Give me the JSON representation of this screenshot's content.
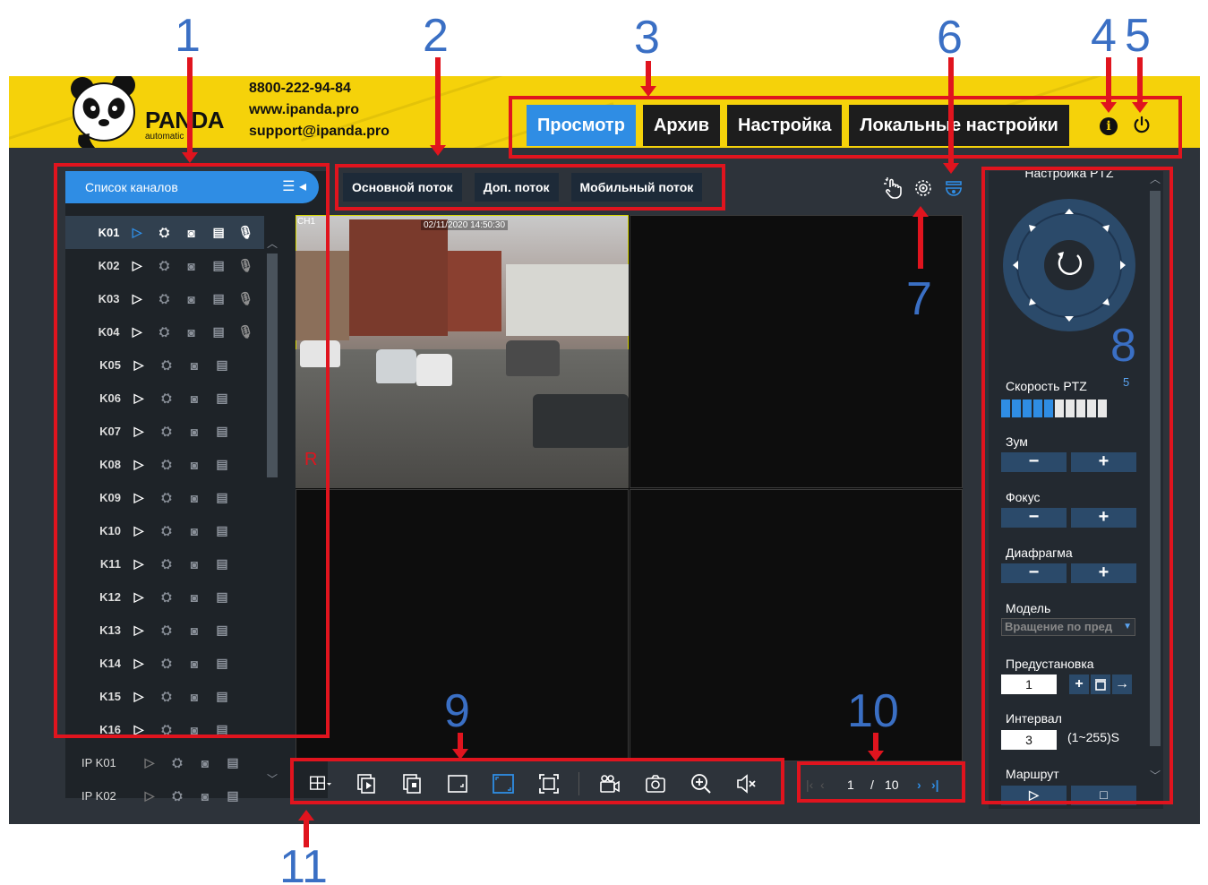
{
  "header": {
    "brand": "PANDA",
    "brand_sub": "automatic",
    "phone": "8800-222-94-84",
    "website": "www.ipanda.pro",
    "email": "support@ipanda.pro",
    "nav": [
      {
        "label": "Просмотр",
        "active": true
      },
      {
        "label": "Архив",
        "active": false
      },
      {
        "label": "Настройка",
        "active": false
      },
      {
        "label": "Локальные настройки",
        "active": false
      }
    ],
    "info_icon": "info-icon",
    "power_icon": "power-icon"
  },
  "annotations": [
    "1",
    "2",
    "3",
    "4",
    "5",
    "6",
    "7",
    "8",
    "9",
    "10",
    "11"
  ],
  "sidebar": {
    "title": "Список каналов",
    "channels": [
      {
        "name": "K01",
        "mic": true,
        "active": true
      },
      {
        "name": "K02",
        "mic": true
      },
      {
        "name": "K03",
        "mic": true
      },
      {
        "name": "K04",
        "mic": true
      },
      {
        "name": "K05"
      },
      {
        "name": "K06"
      },
      {
        "name": "K07"
      },
      {
        "name": "K08"
      },
      {
        "name": "K09"
      },
      {
        "name": "K10"
      },
      {
        "name": "K11"
      },
      {
        "name": "K12"
      },
      {
        "name": "K13"
      },
      {
        "name": "K14"
      },
      {
        "name": "K15"
      },
      {
        "name": "K16"
      },
      {
        "name": "IP K01",
        "ip": true
      },
      {
        "name": "IP K02",
        "ip": true
      }
    ]
  },
  "streams": [
    "Основной поток",
    "Доп. поток",
    "Мобильный поток"
  ],
  "video": {
    "channel_label": "CH1",
    "timestamp": "02/11/2020  14:50:30",
    "rec_marker": "R"
  },
  "pager": {
    "current": "1",
    "separator": "/",
    "total": "10"
  },
  "ptz": {
    "title": "Настройка PTZ",
    "speed_label": "Скорость PTZ",
    "speed_value": "5",
    "speed_level": 5,
    "speed_steps": 10,
    "zoom_label": "Зум",
    "focus_label": "Фокус",
    "iris_label": "Диафрагма",
    "minus": "−",
    "plus": "+",
    "model_label": "Модель",
    "model_value": "Вращение по пред",
    "preset_label": "Предустановка",
    "preset_value": "1",
    "interval_label": "Интервал",
    "interval_value": "3",
    "interval_range": "(1~255)S",
    "route_label": "Маршрут"
  },
  "colors": {
    "accent": "#2f8de4",
    "header_bg": "#f5d20a",
    "annotation_red": "#e0141e",
    "annotation_blue": "#3a6fc4"
  }
}
